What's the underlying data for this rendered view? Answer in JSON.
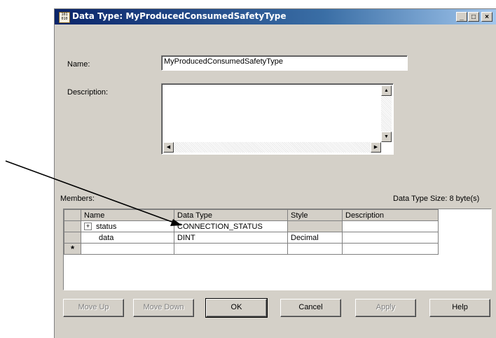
{
  "window": {
    "title": "Data Type: MyProducedConsumedSafetyType",
    "icon_text": "101\n010",
    "controls": {
      "minimize": "_",
      "maximize": "□",
      "close": "×"
    }
  },
  "form": {
    "name_label": "Name:",
    "name_value": "MyProducedConsumedSafetyType",
    "description_label": "Description:",
    "description_value": ""
  },
  "members": {
    "label": "Members:",
    "size_text": "Data Type Size: 8 byte(s)",
    "columns": [
      "Name",
      "Data Type",
      "Style",
      "Description"
    ],
    "rows": [
      {
        "expander": "+",
        "name": "status",
        "data_type": "CONNECTION_STATUS",
        "style": "",
        "description": ""
      },
      {
        "expander": "",
        "name": "data",
        "data_type": "DINT",
        "style": "Decimal",
        "description": ""
      },
      {
        "marker": "*",
        "name": "",
        "data_type": "",
        "style": "",
        "description": ""
      }
    ]
  },
  "buttons": {
    "move_up": "Move Up",
    "move_down": "Move Down",
    "ok": "OK",
    "cancel": "Cancel",
    "apply": "Apply",
    "help": "Help"
  },
  "icons": [
    "app-icon",
    "scroll-up-arrow",
    "scroll-down-arrow",
    "scroll-left-arrow",
    "scroll-right-arrow",
    "annotation-arrow"
  ]
}
